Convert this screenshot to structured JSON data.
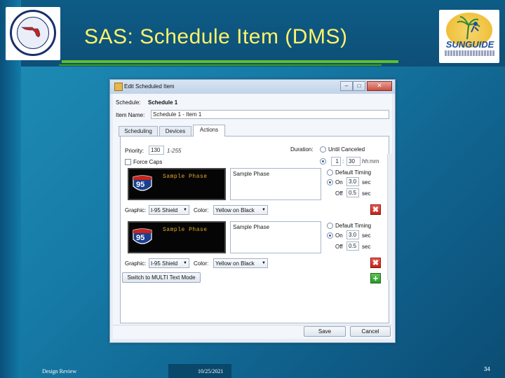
{
  "slide": {
    "title": "SAS: Schedule Item (DMS)",
    "footer_left": "Design Review",
    "footer_date": "10/25/2021",
    "page_number": "34",
    "right_logo_text": "SUNGUIDE"
  },
  "window": {
    "title": "Edit Scheduled Item",
    "minimize_glyph": "–",
    "maximize_glyph": "□",
    "close_glyph": "✕",
    "schedule_label": "Schedule:",
    "schedule_value": "Schedule 1",
    "item_name_label": "Item Name:",
    "item_name_value": "Schedule 1 - Item 1",
    "tabs": [
      {
        "label": "Scheduling",
        "active": false
      },
      {
        "label": "Devices",
        "active": false
      },
      {
        "label": "Actions",
        "active": true
      }
    ],
    "actions": {
      "priority_label": "Priority:",
      "priority_value": "130",
      "priority_range": "1-255",
      "force_caps_label": "Force Caps",
      "duration_label": "Duration:",
      "until_canceled_label": "Until Canceled",
      "duration_hours": "1",
      "duration_sep": ":",
      "duration_minutes": "30",
      "duration_unit": "hh:mm",
      "phases": [
        {
          "sign_text": "Sample Phase",
          "shield_number": "95",
          "message": "Sample Phase",
          "default_timing_label": "Default Timing",
          "on_label": "On",
          "on_value": "3.0",
          "off_label": "Off",
          "off_value": "0.5",
          "sec_label": "sec",
          "graphic_label": "Graphic:",
          "graphic_value": "I-95 Shield",
          "color_label": "Color:",
          "color_value": "Yellow on Black"
        },
        {
          "sign_text": "Sample Phase",
          "shield_number": "95",
          "message": "Sample Phase",
          "default_timing_label": "Default Timing",
          "on_label": "On",
          "on_value": "3.0",
          "off_label": "Off",
          "off_value": "0.5",
          "sec_label": "sec",
          "graphic_label": "Graphic:",
          "graphic_value": "I-95 Shield",
          "color_label": "Color:",
          "color_value": "Yellow on Black"
        }
      ],
      "mode_button": "Switch to MULTI Text Mode",
      "delete_glyph": "✖",
      "add_glyph": "+"
    },
    "save_label": "Save",
    "cancel_label": "Cancel"
  },
  "colors": {
    "title_yellow": "#fff26a",
    "underline_green": "#5fbf2a",
    "sign_amber": "#e3a92a",
    "shield_blue": "#1b3f8f",
    "shield_red": "#c9231b"
  }
}
